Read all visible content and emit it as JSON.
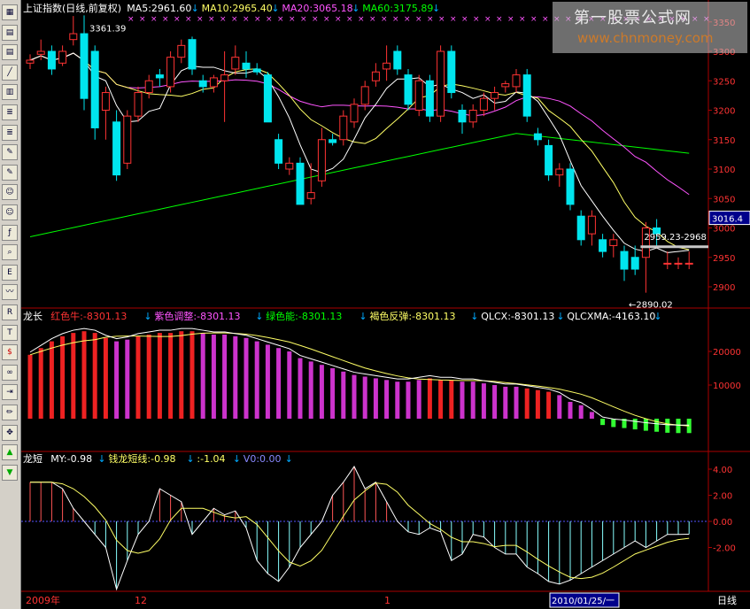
{
  "main_legend": [
    {
      "text": "上证指数(日线,前复权)",
      "color": "#ffffff"
    },
    {
      "text": "MA5:2961.60",
      "color": "#ffffff"
    },
    {
      "text": "MA10:2965.40",
      "color": "#ffff66"
    },
    {
      "text": "MA20:3065.18",
      "color": "#ff55ff"
    },
    {
      "text": "MA60:3175.89",
      "color": "#00ff00"
    }
  ],
  "panel2_legend": [
    {
      "text": "龙长",
      "color": "#ffffff"
    },
    {
      "text": "红色牛:-8301.13",
      "color": "#ff3333"
    },
    {
      "text": "紫色调整:-8301.13",
      "color": "#ff55ff"
    },
    {
      "text": "绿色能:-8301.13",
      "color": "#00ff00"
    },
    {
      "text": "褐色反弹:-8301.13",
      "color": "#ffff66"
    },
    {
      "text": "QLCX:-8301.13",
      "color": "#ffffff"
    },
    {
      "text": "QLCXMA:-4163.10",
      "color": "#ffffff"
    }
  ],
  "panel3_legend": [
    {
      "text": "龙短",
      "color": "#ffffff"
    },
    {
      "text": "MY:-0.98",
      "color": "#ffffff"
    },
    {
      "text": "钱龙短线:-0.98",
      "color": "#ffff66"
    },
    {
      "text": ":-1.04",
      "color": "#ffff66"
    },
    {
      "text": "V0:0.00",
      "color": "#8888ff"
    }
  ],
  "price_axis": [
    "3350",
    "3300",
    "3250",
    "3200",
    "3150",
    "3100",
    "3050",
    "3000",
    "2950",
    "2900"
  ],
  "current_price": "3016.4",
  "annotations": {
    "high": "3361.39",
    "low": "←2890.02",
    "range": "2959.23-2968"
  },
  "panel2_axis": [
    "20000",
    "10000"
  ],
  "panel3_axis": [
    "4.00",
    "2.00",
    "0.00",
    "-2.00"
  ],
  "date_labels": {
    "start": "2009年",
    "tick1": "12",
    "tick2": "1",
    "cursor": "2010/01/25/一",
    "period": "日线"
  },
  "watermark": {
    "line1": "第一股票公式网",
    "line2": "www.chnmoney.com"
  },
  "toolbar_icons": [
    "chart-icon",
    "table-icon",
    "table-icon",
    "line-chart-icon",
    "bars-icon",
    "report-icon",
    "report-icon",
    "note-icon",
    "note-icon",
    "people-icon",
    "people-icon",
    "fx-icon",
    "search-icon",
    "etf-icon",
    "indicator-icon",
    "rsi-icon",
    "text-icon",
    "dollar-icon",
    "link-icon",
    "import-icon",
    "pen-icon",
    "move-icon",
    "up-arrow-icon",
    "down-arrow-icon"
  ],
  "chart_data": {
    "type": "candlestick",
    "candles": [
      [
        3280,
        3295,
        3270,
        3285
      ],
      [
        3295,
        3320,
        3285,
        3300
      ],
      [
        3300,
        3310,
        3260,
        3270
      ],
      [
        3280,
        3310,
        3275,
        3300
      ],
      [
        3320,
        3360,
        3310,
        3330
      ],
      [
        3330,
        3361,
        3200,
        3220
      ],
      [
        3300,
        3310,
        3150,
        3170
      ],
      [
        3200,
        3240,
        3150,
        3230
      ],
      [
        3180,
        3200,
        3080,
        3090
      ],
      [
        3110,
        3200,
        3100,
        3190
      ],
      [
        3190,
        3240,
        3180,
        3230
      ],
      [
        3230,
        3260,
        3220,
        3250
      ],
      [
        3260,
        3270,
        3240,
        3255
      ],
      [
        3240,
        3300,
        3230,
        3290
      ],
      [
        3290,
        3320,
        3280,
        3310
      ],
      [
        3320,
        3325,
        3260,
        3270
      ],
      [
        3250,
        3260,
        3230,
        3240
      ],
      [
        3240,
        3260,
        3230,
        3255
      ],
      [
        3250,
        3300,
        3180,
        3260
      ],
      [
        3270,
        3310,
        3260,
        3290
      ],
      [
        3280,
        3300,
        3255,
        3270
      ],
      [
        3270,
        3280,
        3260,
        3265
      ],
      [
        3260,
        3265,
        3180,
        3180
      ],
      [
        3150,
        3160,
        3100,
        3110
      ],
      [
        3100,
        3120,
        3090,
        3110
      ],
      [
        3110,
        3120,
        3040,
        3040
      ],
      [
        3050,
        3110,
        3040,
        3060
      ],
      [
        3080,
        3170,
        3070,
        3150
      ],
      [
        3150,
        3160,
        3140,
        3145
      ],
      [
        3150,
        3200,
        3140,
        3190
      ],
      [
        3180,
        3220,
        3170,
        3210
      ],
      [
        3210,
        3250,
        3200,
        3240
      ],
      [
        3250,
        3280,
        3240,
        3265
      ],
      [
        3270,
        3310,
        3250,
        3280
      ],
      [
        3300,
        3310,
        3260,
        3270
      ],
      [
        3260,
        3270,
        3200,
        3210
      ],
      [
        3200,
        3260,
        3190,
        3250
      ],
      [
        3250,
        3260,
        3180,
        3190
      ],
      [
        3190,
        3310,
        3180,
        3300
      ],
      [
        3300,
        3310,
        3220,
        3230
      ],
      [
        3200,
        3210,
        3160,
        3180
      ],
      [
        3180,
        3210,
        3170,
        3200
      ],
      [
        3200,
        3230,
        3190,
        3220
      ],
      [
        3220,
        3240,
        3200,
        3230
      ],
      [
        3240,
        3250,
        3230,
        3245
      ],
      [
        3240,
        3270,
        3230,
        3260
      ],
      [
        3260,
        3270,
        3180,
        3190
      ],
      [
        3160,
        3170,
        3140,
        3150
      ],
      [
        3140,
        3150,
        3080,
        3090
      ],
      [
        3090,
        3110,
        3070,
        3100
      ],
      [
        3100,
        3110,
        3030,
        3040
      ],
      [
        3020,
        3030,
        2970,
        2980
      ],
      [
        2990,
        3030,
        2970,
        3020
      ],
      [
        2980,
        2990,
        2950,
        2960
      ],
      [
        2970,
        2990,
        2950,
        2980
      ],
      [
        2960,
        2970,
        2910,
        2930
      ],
      [
        2950,
        2970,
        2920,
        2930
      ],
      [
        2950,
        3010,
        2890,
        3000
      ],
      [
        3000,
        3015,
        2970,
        2990
      ],
      [
        2940,
        2960,
        2930,
        2940
      ],
      [
        2940,
        2950,
        2930,
        2940
      ],
      [
        2940,
        2960,
        2930,
        2940
      ]
    ],
    "panel2_values": [
      19000,
      21000,
      23000,
      24500,
      25500,
      26000,
      25500,
      24000,
      23000,
      23500,
      24500,
      25000,
      25500,
      25500,
      26000,
      26000,
      25500,
      25000,
      25000,
      24500,
      24000,
      23000,
      22000,
      21000,
      20000,
      18000,
      17000,
      16000,
      15000,
      14000,
      13000,
      12500,
      12000,
      11500,
      11000,
      11000,
      11500,
      12000,
      11500,
      11500,
      11000,
      11000,
      10500,
      10000,
      9500,
      9500,
      9000,
      8500,
      8000,
      7000,
      5000,
      4000,
      2000,
      -300,
      -900,
      -1200,
      -1600,
      -2000,
      -2300,
      -2600,
      -2700,
      -2700
    ]
  }
}
